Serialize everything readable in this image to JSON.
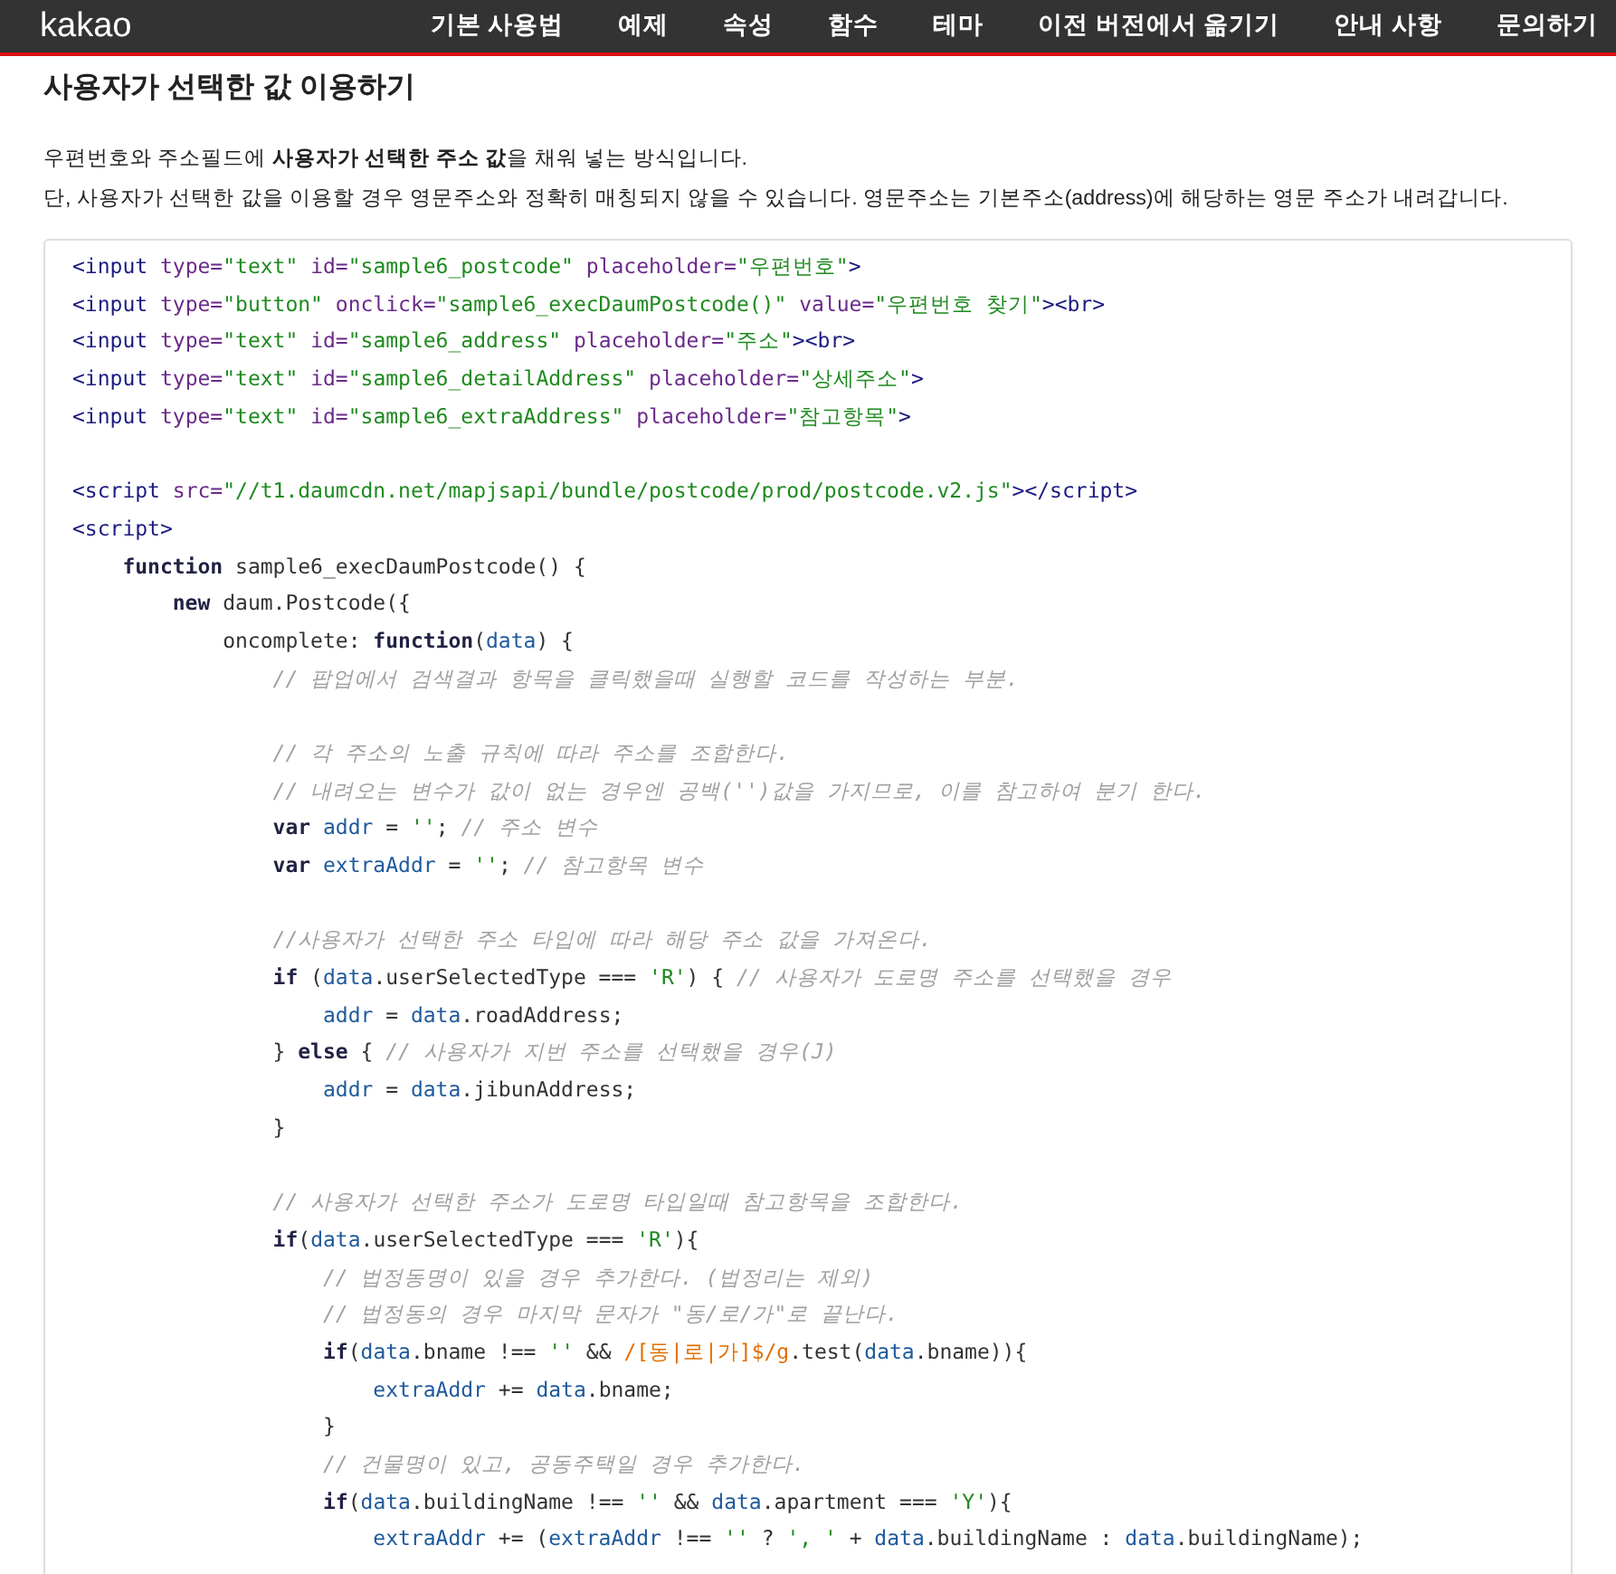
{
  "header": {
    "logo": "kakao",
    "nav": [
      "기본 사용법",
      "예제",
      "속성",
      "함수",
      "테마",
      "이전 버전에서 옮기기",
      "안내 사항",
      "문의하기"
    ]
  },
  "title": "사용자가 선택한 값 이용하기",
  "description": [
    "우편번호와 주소필드에 **사용자가 선택한 주소 값**을 채워 넣는 방식입니다.",
    "단, 사용자가 선택한 값을 이용할 경우 영문주소와 정확히 매칭되지 않을 수 있습니다. 영문주소는 기본주소(address)에 해당하는 영문 주소가 내려갑니다."
  ],
  "code": [
    {
      "kind": "code",
      "tokens": [
        {
          "kind": "tag",
          "text": "<input"
        },
        {
          "kind": "attr",
          "text": " type="
        },
        {
          "kind": "str",
          "text": "\"text\""
        },
        {
          "kind": "attr",
          "text": " id="
        },
        {
          "kind": "str",
          "text": "\"sample6_postcode\""
        },
        {
          "kind": "attr",
          "text": " placeholder="
        },
        {
          "kind": "str",
          "text": "\"우편번호\""
        },
        {
          "kind": "tag",
          "text": ">"
        }
      ]
    },
    {
      "kind": "code",
      "tokens": [
        {
          "kind": "tag",
          "text": "<input"
        },
        {
          "kind": "attr",
          "text": " type="
        },
        {
          "kind": "str",
          "text": "\"button\""
        },
        {
          "kind": "attr",
          "text": " onclick="
        },
        {
          "kind": "str",
          "text": "\"sample6_execDaumPostcode()\""
        },
        {
          "kind": "attr",
          "text": " value="
        },
        {
          "kind": "str",
          "text": "\"우편번호 찾기\""
        },
        {
          "kind": "tag",
          "text": "><br>"
        }
      ]
    },
    {
      "kind": "code",
      "tokens": [
        {
          "kind": "tag",
          "text": "<input"
        },
        {
          "kind": "attr",
          "text": " type="
        },
        {
          "kind": "str",
          "text": "\"text\""
        },
        {
          "kind": "attr",
          "text": " id="
        },
        {
          "kind": "str",
          "text": "\"sample6_address\""
        },
        {
          "kind": "attr",
          "text": " placeholder="
        },
        {
          "kind": "str",
          "text": "\"주소\""
        },
        {
          "kind": "tag",
          "text": "><br>"
        }
      ]
    },
    {
      "kind": "code",
      "tokens": [
        {
          "kind": "tag",
          "text": "<input"
        },
        {
          "kind": "attr",
          "text": " type="
        },
        {
          "kind": "str",
          "text": "\"text\""
        },
        {
          "kind": "attr",
          "text": " id="
        },
        {
          "kind": "str",
          "text": "\"sample6_detailAddress\""
        },
        {
          "kind": "attr",
          "text": " placeholder="
        },
        {
          "kind": "str",
          "text": "\"상세주소\""
        },
        {
          "kind": "tag",
          "text": ">"
        }
      ]
    },
    {
      "kind": "code",
      "tokens": [
        {
          "kind": "tag",
          "text": "<input"
        },
        {
          "kind": "attr",
          "text": " type="
        },
        {
          "kind": "str",
          "text": "\"text\""
        },
        {
          "kind": "attr",
          "text": " id="
        },
        {
          "kind": "str",
          "text": "\"sample6_extraAddress\""
        },
        {
          "kind": "attr",
          "text": " placeholder="
        },
        {
          "kind": "str",
          "text": "\"참고항목\""
        },
        {
          "kind": "tag",
          "text": ">"
        }
      ]
    },
    {
      "kind": "blank"
    },
    {
      "kind": "code",
      "tokens": [
        {
          "kind": "tag",
          "text": "<script"
        },
        {
          "kind": "attr",
          "text": " src="
        },
        {
          "kind": "str",
          "text": "\"//t1.daumcdn.net/mapjsapi/bundle/postcode/prod/postcode.v2.js\""
        },
        {
          "kind": "tag",
          "text": "></script>"
        }
      ]
    },
    {
      "kind": "code",
      "tokens": [
        {
          "kind": "tag",
          "text": "<script>"
        }
      ]
    },
    {
      "kind": "code",
      "tokens": [
        {
          "kind": "kw",
          "text": "    function"
        },
        {
          "kind": "plain",
          "text": " sample6_execDaumPostcode() {"
        }
      ]
    },
    {
      "kind": "code",
      "tokens": [
        {
          "kind": "kw",
          "text": "        new"
        },
        {
          "kind": "plain",
          "text": " daum.Postcode({"
        }
      ]
    },
    {
      "kind": "code",
      "tokens": [
        {
          "kind": "plain",
          "text": "            oncomplete: "
        },
        {
          "kind": "kw",
          "text": "function"
        },
        {
          "kind": "plain",
          "text": "("
        },
        {
          "kind": "var",
          "text": "data"
        },
        {
          "kind": "plain",
          "text": ") {"
        }
      ]
    },
    {
      "kind": "code",
      "tokens": [
        {
          "kind": "cmt",
          "text": "                // 팝업에서 검색결과 항목을 클릭했을때 실행할 코드를 작성하는 부분."
        }
      ]
    },
    {
      "kind": "blank"
    },
    {
      "kind": "code",
      "tokens": [
        {
          "kind": "cmt",
          "text": "                // 각 주소의 노출 규칙에 따라 주소를 조합한다."
        }
      ]
    },
    {
      "kind": "code",
      "tokens": [
        {
          "kind": "cmt",
          "text": "                // 내려오는 변수가 값이 없는 경우엔 공백('')값을 가지므로, 이를 참고하여 분기 한다."
        }
      ]
    },
    {
      "kind": "code",
      "tokens": [
        {
          "kind": "kw",
          "text": "                var "
        },
        {
          "kind": "var",
          "text": "addr"
        },
        {
          "kind": "plain",
          "text": " = "
        },
        {
          "kind": "str",
          "text": "''"
        },
        {
          "kind": "plain",
          "text": "; "
        },
        {
          "kind": "cmt",
          "text": "// 주소 변수"
        }
      ]
    },
    {
      "kind": "code",
      "tokens": [
        {
          "kind": "kw",
          "text": "                var "
        },
        {
          "kind": "var",
          "text": "extraAddr"
        },
        {
          "kind": "plain",
          "text": " = "
        },
        {
          "kind": "str",
          "text": "''"
        },
        {
          "kind": "plain",
          "text": "; "
        },
        {
          "kind": "cmt",
          "text": "// 참고항목 변수"
        }
      ]
    },
    {
      "kind": "blank"
    },
    {
      "kind": "code",
      "tokens": [
        {
          "kind": "cmt",
          "text": "                //사용자가 선택한 주소 타입에 따라 해당 주소 값을 가져온다."
        }
      ]
    },
    {
      "kind": "code",
      "tokens": [
        {
          "kind": "kw",
          "text": "                if"
        },
        {
          "kind": "plain",
          "text": " ("
        },
        {
          "kind": "var",
          "text": "data"
        },
        {
          "kind": "plain",
          "text": ".userSelectedType === "
        },
        {
          "kind": "str",
          "text": "'R'"
        },
        {
          "kind": "plain",
          "text": ") { "
        },
        {
          "kind": "cmt",
          "text": "// 사용자가 도로명 주소를 선택했을 경우"
        }
      ]
    },
    {
      "kind": "code",
      "tokens": [
        {
          "kind": "var",
          "text": "                    addr"
        },
        {
          "kind": "plain",
          "text": " = "
        },
        {
          "kind": "var",
          "text": "data"
        },
        {
          "kind": "plain",
          "text": ".roadAddress;"
        }
      ]
    },
    {
      "kind": "code",
      "tokens": [
        {
          "kind": "plain",
          "text": "                } "
        },
        {
          "kind": "kw",
          "text": "else"
        },
        {
          "kind": "plain",
          "text": " { "
        },
        {
          "kind": "cmt",
          "text": "// 사용자가 지번 주소를 선택했을 경우(J)"
        }
      ]
    },
    {
      "kind": "code",
      "tokens": [
        {
          "kind": "var",
          "text": "                    addr"
        },
        {
          "kind": "plain",
          "text": " = "
        },
        {
          "kind": "var",
          "text": "data"
        },
        {
          "kind": "plain",
          "text": ".jibunAddress;"
        }
      ]
    },
    {
      "kind": "code",
      "tokens": [
        {
          "kind": "plain",
          "text": "                }"
        }
      ]
    },
    {
      "kind": "blank"
    },
    {
      "kind": "code",
      "tokens": [
        {
          "kind": "cmt",
          "text": "                // 사용자가 선택한 주소가 도로명 타입일때 참고항목을 조합한다."
        }
      ]
    },
    {
      "kind": "code",
      "tokens": [
        {
          "kind": "kw",
          "text": "                if"
        },
        {
          "kind": "plain",
          "text": "("
        },
        {
          "kind": "var",
          "text": "data"
        },
        {
          "kind": "plain",
          "text": ".userSelectedType === "
        },
        {
          "kind": "str",
          "text": "'R'"
        },
        {
          "kind": "plain",
          "text": "){"
        }
      ]
    },
    {
      "kind": "code",
      "tokens": [
        {
          "kind": "cmt",
          "text": "                    // 법정동명이 있을 경우 추가한다. (법정리는 제외)"
        }
      ]
    },
    {
      "kind": "code",
      "tokens": [
        {
          "kind": "cmt",
          "text": "                    // 법정동의 경우 마지막 문자가 \"동/로/가\"로 끝난다."
        }
      ]
    },
    {
      "kind": "code",
      "tokens": [
        {
          "kind": "kw",
          "text": "                    if"
        },
        {
          "kind": "plain",
          "text": "("
        },
        {
          "kind": "var",
          "text": "data"
        },
        {
          "kind": "plain",
          "text": ".bname !== "
        },
        {
          "kind": "str",
          "text": "''"
        },
        {
          "kind": "plain",
          "text": " && "
        },
        {
          "kind": "rgx",
          "text": "/[동|로|가]$/g"
        },
        {
          "kind": "plain",
          "text": ".test("
        },
        {
          "kind": "var",
          "text": "data"
        },
        {
          "kind": "plain",
          "text": ".bname)){"
        }
      ]
    },
    {
      "kind": "code",
      "tokens": [
        {
          "kind": "var",
          "text": "                        extraAddr"
        },
        {
          "kind": "plain",
          "text": " += "
        },
        {
          "kind": "var",
          "text": "data"
        },
        {
          "kind": "plain",
          "text": ".bname;"
        }
      ]
    },
    {
      "kind": "code",
      "tokens": [
        {
          "kind": "plain",
          "text": "                    }"
        }
      ]
    },
    {
      "kind": "code",
      "tokens": [
        {
          "kind": "cmt",
          "text": "                    // 건물명이 있고, 공동주택일 경우 추가한다."
        }
      ]
    },
    {
      "kind": "code",
      "tokens": [
        {
          "kind": "kw",
          "text": "                    if"
        },
        {
          "kind": "plain",
          "text": "("
        },
        {
          "kind": "var",
          "text": "data"
        },
        {
          "kind": "plain",
          "text": ".buildingName !== "
        },
        {
          "kind": "str",
          "text": "''"
        },
        {
          "kind": "plain",
          "text": " && "
        },
        {
          "kind": "var",
          "text": "data"
        },
        {
          "kind": "plain",
          "text": ".apartment === "
        },
        {
          "kind": "str",
          "text": "'Y'"
        },
        {
          "kind": "plain",
          "text": "){"
        }
      ]
    },
    {
      "kind": "code",
      "tokens": [
        {
          "kind": "var",
          "text": "                        extraAddr"
        },
        {
          "kind": "plain",
          "text": " += ("
        },
        {
          "kind": "var",
          "text": "extraAddr"
        },
        {
          "kind": "plain",
          "text": " !== "
        },
        {
          "kind": "str",
          "text": "''"
        },
        {
          "kind": "plain",
          "text": " ? "
        },
        {
          "kind": "str",
          "text": "', '"
        },
        {
          "kind": "plain",
          "text": " + "
        },
        {
          "kind": "var",
          "text": "data"
        },
        {
          "kind": "plain",
          "text": ".buildingName : "
        },
        {
          "kind": "var",
          "text": "data"
        },
        {
          "kind": "plain",
          "text": ".buildingName);"
        }
      ]
    }
  ]
}
